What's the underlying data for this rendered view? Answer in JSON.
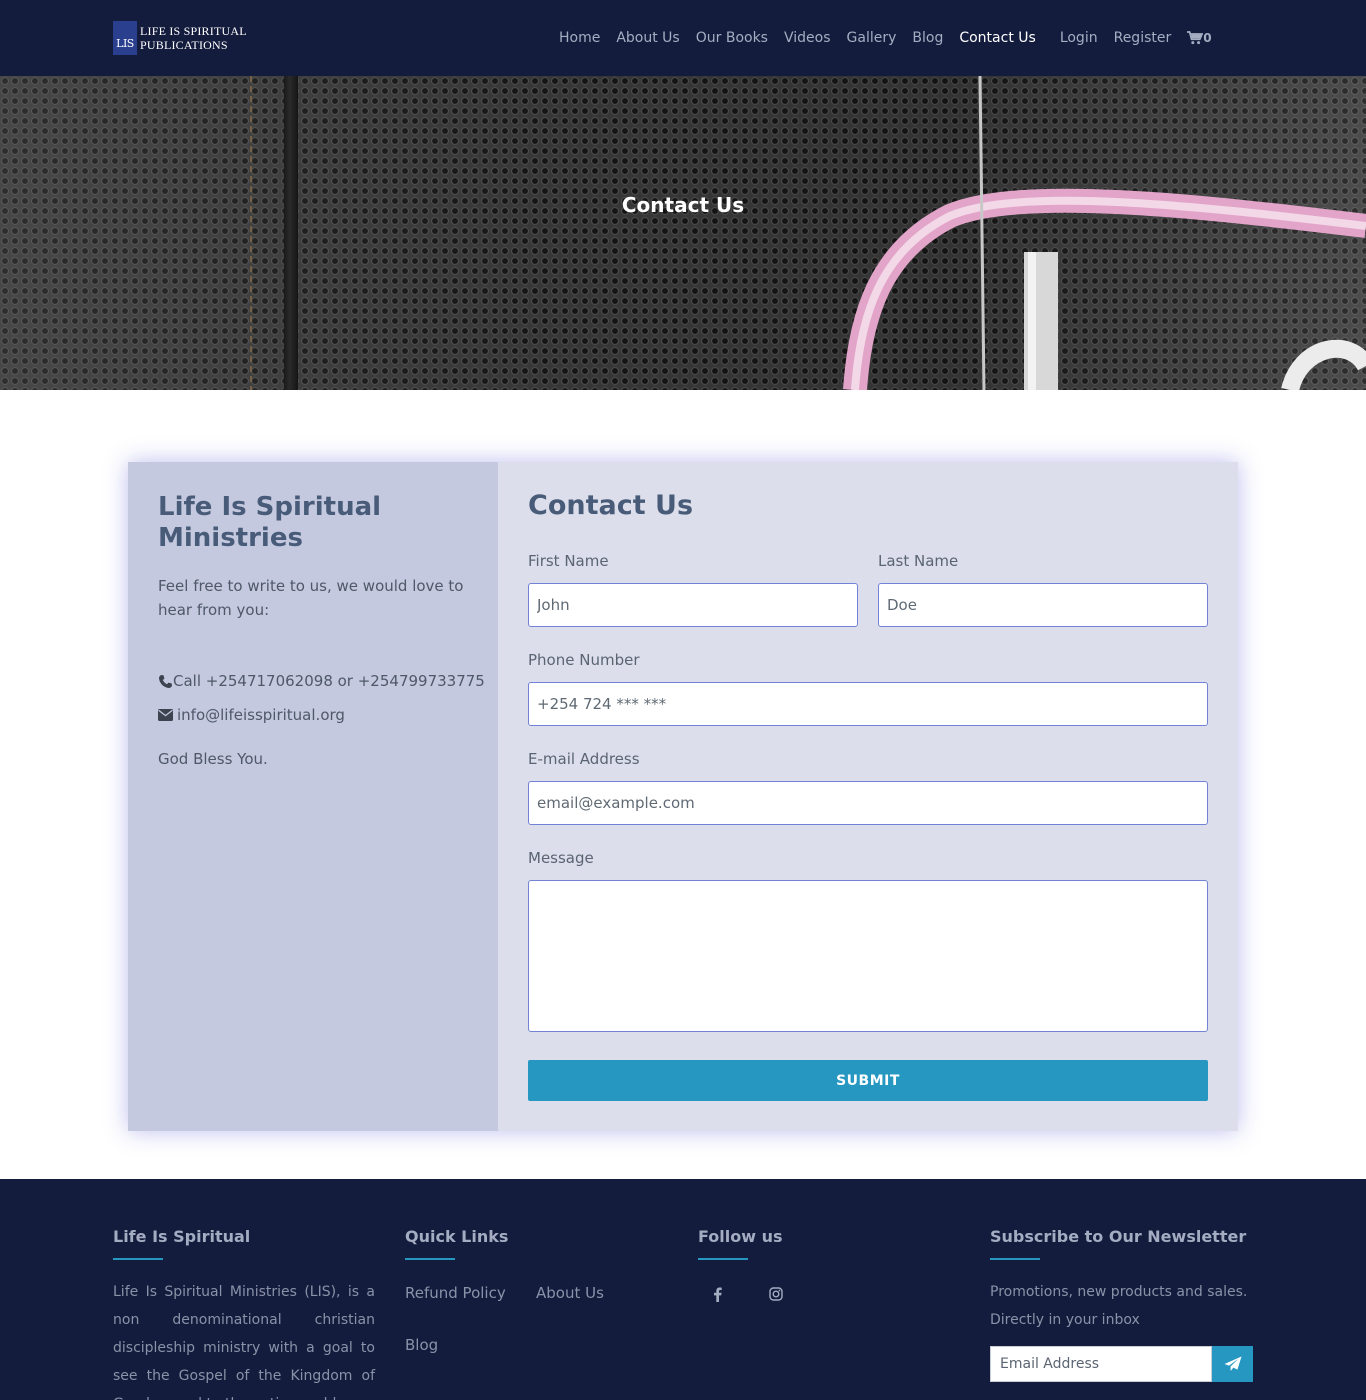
{
  "nav": {
    "logo_mark": "LIS",
    "logo_line1": "LIFE IS SPIRITUAL",
    "logo_line2": "PUBLICATIONS",
    "links": [
      {
        "label": "Home",
        "active": false
      },
      {
        "label": "About Us",
        "active": false
      },
      {
        "label": "Our Books",
        "active": false
      },
      {
        "label": "Videos",
        "active": false
      },
      {
        "label": "Gallery",
        "active": false
      },
      {
        "label": "Blog",
        "active": false
      },
      {
        "label": "Contact Us",
        "active": true
      }
    ],
    "login": "Login",
    "register": "Register",
    "cart_icon": "cart-icon",
    "cart_count": "0"
  },
  "hero": {
    "title": "Contact Us"
  },
  "info": {
    "title": "Life Is Spiritual Ministries",
    "intro": "Feel free to write to us, we would love to hear from you:",
    "phone_icon": "phone-icon",
    "phone": "Call +254717062098 or +254799733775",
    "email_icon": "envelope-icon",
    "email": "info@lifeisspiritual.org",
    "blessing": "God Bless You."
  },
  "form": {
    "title": "Contact Us",
    "first_name_label": "First Name",
    "first_name_placeholder": "John",
    "last_name_label": "Last Name",
    "last_name_placeholder": "Doe",
    "phone_label": "Phone Number",
    "phone_placeholder": "+254 724 *** ***",
    "email_label": "E-mail Address",
    "email_placeholder": "email@example.com",
    "message_label": "Message",
    "submit_label": "SUBMIT"
  },
  "footer": {
    "about_title": "Life Is Spiritual",
    "about_text": "Life Is Spiritual Ministries (LIS), is a non denominational christian discipleship ministry with a goal to see the Gospel of the Kingdom of Goad spread to the entire world.",
    "links_title": "Quick Links",
    "links": [
      "Refund Policy",
      "About Us",
      "Blog"
    ],
    "follow_title": "Follow us",
    "social_icons": [
      "facebook-icon",
      "instagram-icon"
    ],
    "news_title": "Subscribe to Our Newsletter",
    "news_text": "Promotions, new products and sales. Directly in your inbox",
    "news_placeholder": "Email Address",
    "news_button_icon": "paper-plane-icon"
  },
  "colors": {
    "nav_bg": "#141c3e",
    "accent": "#2597c1",
    "info_panel": "#c4c9df",
    "form_panel": "#dcdfeb",
    "heading": "#485b78"
  }
}
